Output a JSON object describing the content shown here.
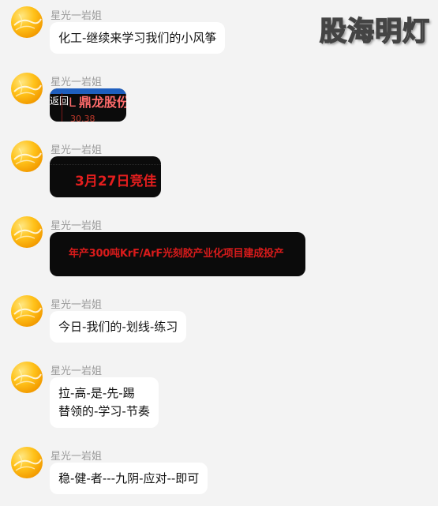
{
  "watermark": "股海明灯",
  "colors": {
    "background": "#f3f3f3",
    "bubble": "#ffffff",
    "sender_name": "#9a9a9a",
    "image_text_red": "#e41e1e"
  },
  "messages": [
    {
      "sender": "星光一岩姐",
      "avatar": "golden-ball-avatar",
      "type": "text",
      "lines": [
        "化工-继续来学习我们的小风筝"
      ]
    },
    {
      "sender": "星光一岩姐",
      "avatar": "golden-ball-avatar",
      "type": "image",
      "image": {
        "back_label": "返回",
        "letter": "L",
        "title": "鼎龙股份",
        "bottom": "30.38"
      }
    },
    {
      "sender": "星光一岩姐",
      "avatar": "golden-ball-avatar",
      "type": "image",
      "image": {
        "text": "3月27日竞佳"
      }
    },
    {
      "sender": "星光一岩姐",
      "avatar": "golden-ball-avatar",
      "type": "image",
      "image": {
        "text": "年产300吨KrF/ArF光刻胶产业化项目建成投产"
      }
    },
    {
      "sender": "星光一岩姐",
      "avatar": "golden-ball-avatar",
      "type": "text",
      "lines": [
        "今日-我们的-划线-练习"
      ]
    },
    {
      "sender": "星光一岩姐",
      "avatar": "golden-ball-avatar",
      "type": "text",
      "lines": [
        "拉-高-是-先-踢",
        "替领的-学习-节奏"
      ]
    },
    {
      "sender": "星光一岩姐",
      "avatar": "golden-ball-avatar",
      "type": "text",
      "lines": [
        "稳-健-者---九阴-应对--即可"
      ]
    }
  ]
}
